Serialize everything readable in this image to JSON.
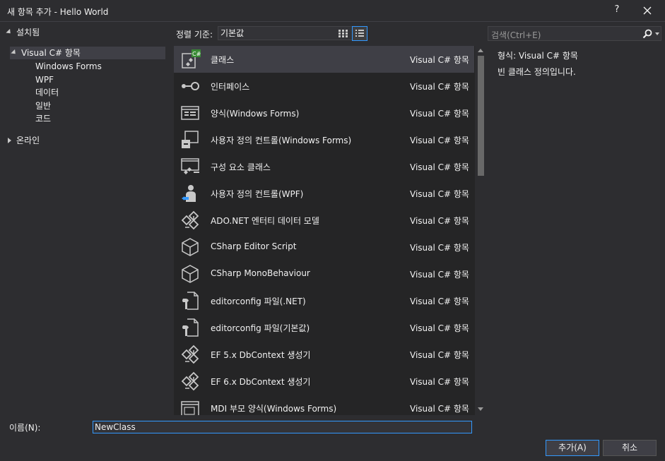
{
  "window": {
    "title": "새 항목 추가 - Hello World",
    "help_label": "?",
    "close_icon": "close-icon"
  },
  "tree": {
    "installed_label": "설치됨",
    "csharp_label": "Visual C# 항목",
    "children": [
      "Windows Forms",
      "WPF",
      "데이터",
      "일반",
      "코드"
    ],
    "online_label": "온라인"
  },
  "sort": {
    "label": "정렬 기준:",
    "selected": "기본값",
    "grid_view_icon": "grid-view-icon",
    "list_view_icon": "list-view-icon"
  },
  "search": {
    "placeholder": "검색(Ctrl+E)",
    "icon": "search-icon"
  },
  "templates": [
    {
      "name": "클래스",
      "type": "Visual C# 항목",
      "icon": "class-icon",
      "selected": true
    },
    {
      "name": "인터페이스",
      "type": "Visual C# 항목",
      "icon": "interface-icon"
    },
    {
      "name": "양식(Windows Forms)",
      "type": "Visual C# 항목",
      "icon": "form-icon"
    },
    {
      "name": "사용자 정의 컨트롤(Windows Forms)",
      "type": "Visual C# 항목",
      "icon": "user-control-icon"
    },
    {
      "name": "구성 요소 클래스",
      "type": "Visual C# 항목",
      "icon": "component-class-icon"
    },
    {
      "name": "사용자 정의 컨트롤(WPF)",
      "type": "Visual C# 항목",
      "icon": "wpf-user-control-icon"
    },
    {
      "name": "ADO.NET 엔터티 데이터 모델",
      "type": "Visual C# 항목",
      "icon": "entity-model-icon"
    },
    {
      "name": "CSharp Editor Script",
      "type": "Visual C# 항목",
      "icon": "cube-icon"
    },
    {
      "name": "CSharp MonoBehaviour",
      "type": "Visual C# 항목",
      "icon": "cube-icon"
    },
    {
      "name": "editorconfig 파일(.NET)",
      "type": "Visual C# 항목",
      "icon": "config-file-icon"
    },
    {
      "name": "editorconfig 파일(기본값)",
      "type": "Visual C# 항목",
      "icon": "config-file-icon"
    },
    {
      "name": "EF 5.x DbContext 생성기",
      "type": "Visual C# 항목",
      "icon": "generator-icon"
    },
    {
      "name": "EF 6.x DbContext 생성기",
      "type": "Visual C# 항목",
      "icon": "generator-icon"
    },
    {
      "name": "MDI 부모 양식(Windows Forms)",
      "type": "Visual C# 항목",
      "icon": "mdi-form-icon"
    }
  ],
  "details": {
    "type_label": "형식:",
    "type_value": "Visual C# 항목",
    "description": "빈 클래스 정의입니다."
  },
  "footer": {
    "name_label": "이름(N):",
    "name_value": "NewClass",
    "add_label": "추가(A)",
    "cancel_label": "취소"
  },
  "colors": {
    "background": "#2d2d30",
    "list_background": "#252526",
    "selection": "#3f3f46",
    "accent": "#3399ff",
    "text": "#f1f1f1"
  }
}
